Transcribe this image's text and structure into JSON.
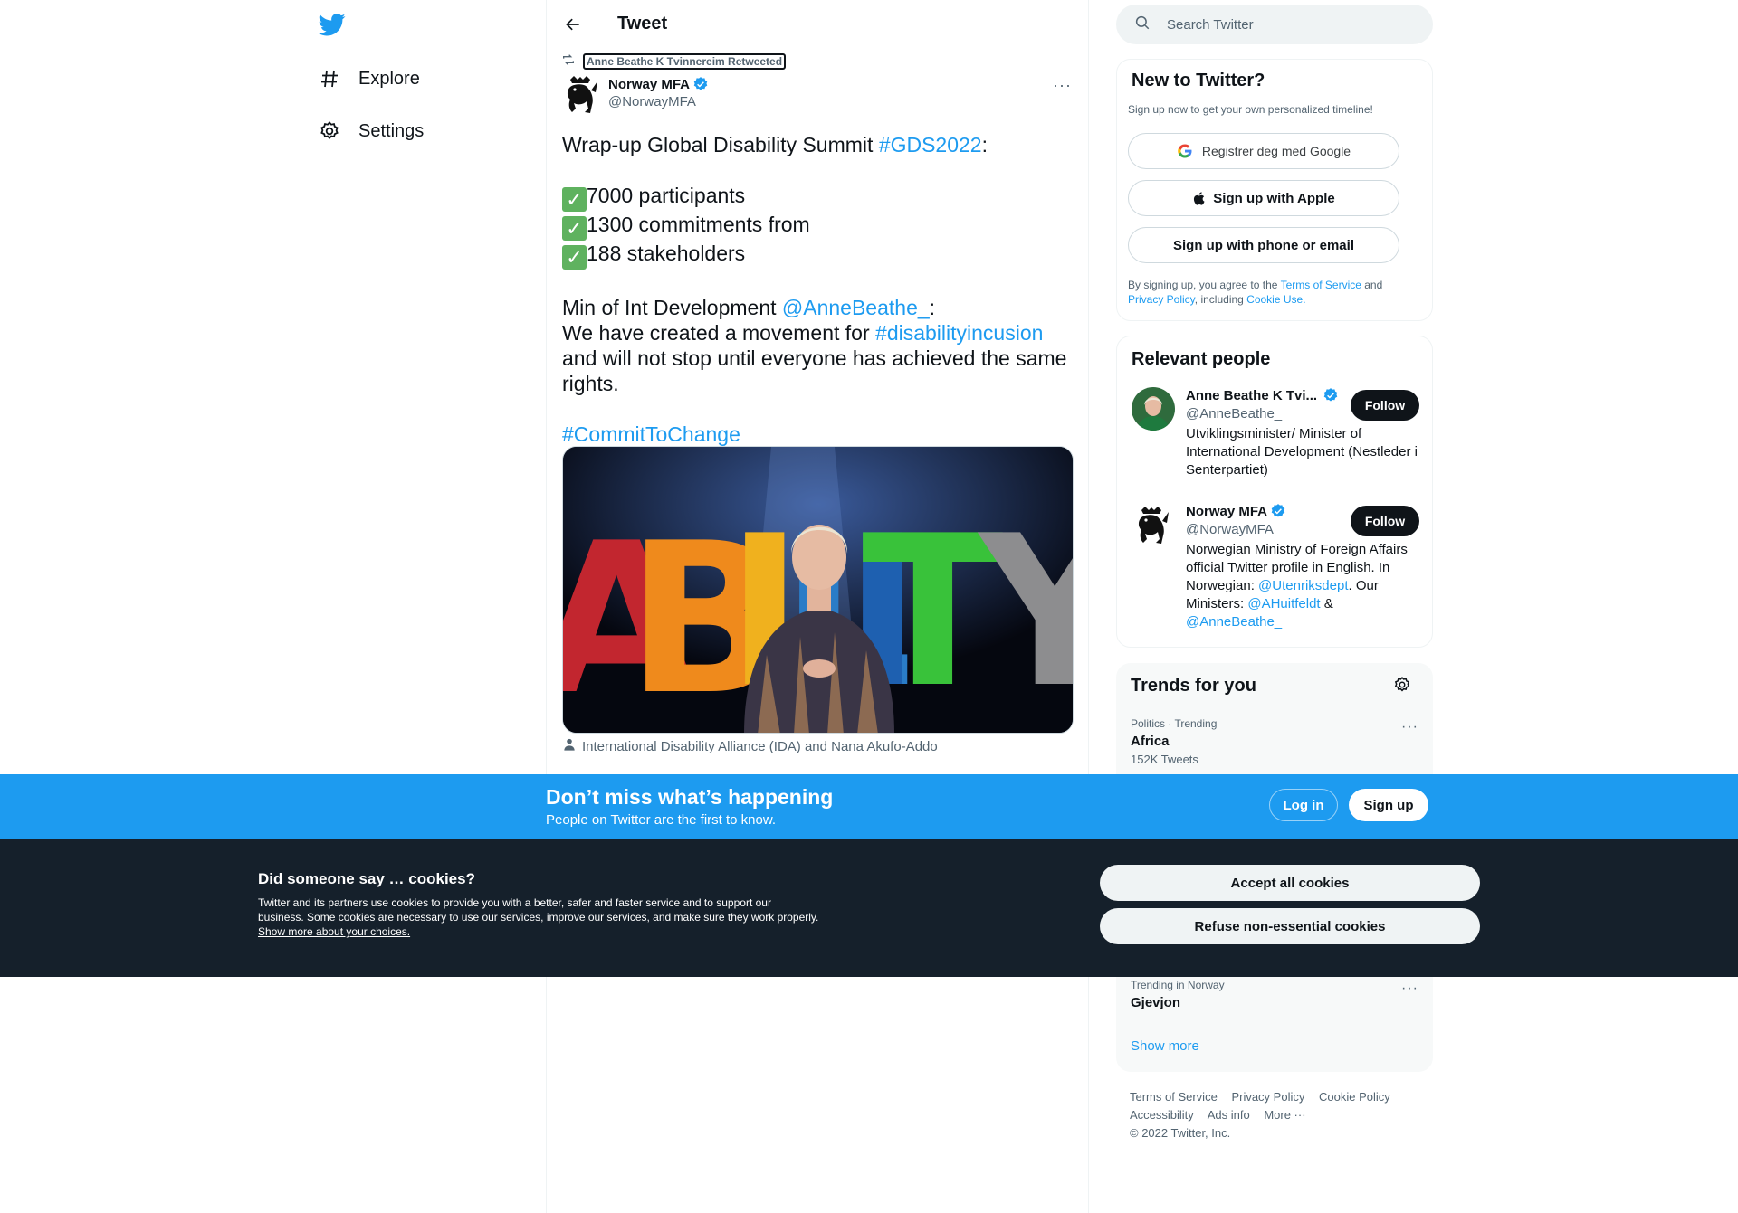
{
  "nav": {
    "items": [
      {
        "label": "Explore"
      },
      {
        "label": "Settings"
      }
    ]
  },
  "header": {
    "title": "Tweet"
  },
  "tweet": {
    "retweeted_by": "Anne Beathe K Tvinnereim Retweeted",
    "author_name": "Norway MFA",
    "author_handle": "@NorwayMFA",
    "line1_text": "Wrap-up Global Disability Summit ",
    "line1_tag": "#GDS2022",
    "line1_end": ":",
    "bullets": [
      "7000 participants",
      "1300 commitments from",
      "188 stakeholders"
    ],
    "min_text": "Min of Int Development ",
    "min_mention": "@AnneBeathe_",
    "min_end": ":",
    "movement_text": "We have created a movement for ",
    "movement_tag": "#disabilityincusion",
    "rights_text": "and will not stop until everyone has achieved the same rights.",
    "commit_tag": "#CommitToChange",
    "media_letters": [
      "A",
      "B",
      "I",
      "L",
      "I",
      "T",
      "Y"
    ],
    "tagged_people": "International Disability Alliance (IDA) and Nana Akufo-Addo"
  },
  "search": {
    "placeholder": "Search Twitter"
  },
  "new_to_twitter": {
    "title": "New to Twitter?",
    "subtitle": "Sign up now to get your own personalized timeline!",
    "google_label": "Registrer deg med Google",
    "apple_label": "Sign up with Apple",
    "phone_label": "Sign up with phone or email",
    "legal_prefix": "By signing up, you agree to the ",
    "terms_link": "Terms of Service",
    "and": " and",
    "privacy_link": "Privacy Policy",
    "including": ", including ",
    "cookie_link": "Cookie Use."
  },
  "relevant_people": {
    "title": "Relevant people",
    "people": [
      {
        "name": "Anne Beathe K Tvi...",
        "handle": "@AnneBeathe_",
        "bio": "Utviklingsminister/ Minister of International Development (Nestleder i Senterpartiet)",
        "follow": "Follow"
      },
      {
        "name": "Norway MFA",
        "handle": "@NorwayMFA",
        "bio_start": "Norwegian Ministry of Foreign Affairs official Twitter profile in English. In Norwegian: ",
        "bio_mention1": "@Utenriksdept",
        "bio_mid": ". Our Ministers: ",
        "bio_mention2": "@AHuitfeldt",
        "bio_amp": " & ",
        "bio_mention3": "@AnneBeathe_",
        "follow": "Follow"
      }
    ]
  },
  "trends": {
    "title": "Trends for you",
    "items": [
      {
        "meta": "Politics · Trending",
        "name": "Africa",
        "count": "152K Tweets"
      },
      {
        "meta": "Trending in Norway",
        "name": "Gjevjon"
      }
    ],
    "show_more": "Show more"
  },
  "footer": {
    "links": [
      "Terms of Service",
      "Privacy Policy",
      "Cookie Policy",
      "Accessibility",
      "Ads info",
      "More ···"
    ],
    "copyright": "© 2022 Twitter, Inc."
  },
  "signup_bar": {
    "title": "Don’t miss what’s happening",
    "subtitle": "People on Twitter are the first to know.",
    "login": "Log in",
    "signup": "Sign up"
  },
  "cookies": {
    "title": "Did someone say … cookies?",
    "text": "Twitter and its partners use cookies to provide you with a better, safer and faster service and to support our business. Some cookies are necessary to use our services, improve our services, and make sure they work properly. ",
    "link": "Show more about your choices.",
    "accept": "Accept all cookies",
    "refuse": "Refuse non-essential cookies"
  },
  "colors": {
    "accent": "#1d9bf0",
    "dark": "#0f1419",
    "muted": "#536471",
    "cookie_bg": "#15202b"
  }
}
